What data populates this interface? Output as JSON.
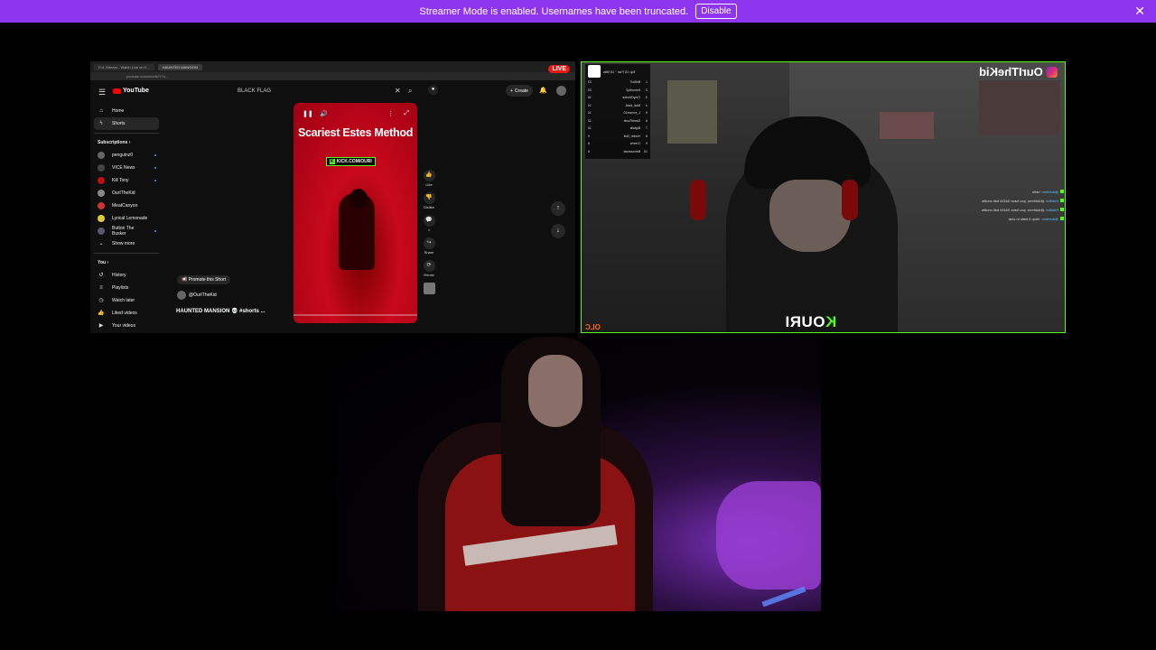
{
  "banner": {
    "message": "Streamer Mode is enabled. Usernames have been truncated.",
    "disable_label": "Disable",
    "close_glyph": "✕",
    "color": "#8e35f0"
  },
  "browser": {
    "tabs": [
      "Fu1 Stream - Watch Live on K...",
      "HAUNTED MANSION"
    ],
    "url": "youtube.com/shorts/Y7x...",
    "live_badge": "LIVE",
    "youtube": {
      "logo_text": "YouTube",
      "search_query": "BLACK FLAG",
      "create_label": "Create",
      "sidebar": {
        "items": [
          {
            "label": "Home",
            "icon": "home-icon",
            "glyph": "⌂"
          },
          {
            "label": "Shorts",
            "icon": "shorts-icon",
            "glyph": "ϟ"
          }
        ],
        "subscriptions_heading": "Subscriptions",
        "subscriptions": [
          {
            "label": "penguinz0",
            "color": "#666"
          },
          {
            "label": "VICE News",
            "color": "#444"
          },
          {
            "label": "Kill Tony",
            "color": "#b11"
          },
          {
            "label": "OurITheKid",
            "color": "#888"
          },
          {
            "label": "MeatCanyon",
            "color": "#c33"
          },
          {
            "label": "Lyrical Lemonade",
            "color": "#dc3"
          },
          {
            "label": "Button The Busker",
            "color": "#557"
          }
        ],
        "show_more": "Show more",
        "you_heading": "You",
        "you_items": [
          {
            "label": "History",
            "glyph": "↺"
          },
          {
            "label": "Playlists",
            "glyph": "≡"
          },
          {
            "label": "Watch later",
            "glyph": "◷"
          },
          {
            "label": "Liked videos",
            "glyph": "👍"
          },
          {
            "label": "Your videos",
            "glyph": "▶"
          }
        ]
      },
      "short": {
        "title_overlay": "Scariest Estes Method",
        "kick_tag": "KICK.COM/OURI",
        "promote_label": "Promote this Short",
        "channel": "@OurITheKid",
        "video_title": "HAUNTED MANSION 💀 #shorts ..."
      },
      "actions": [
        {
          "label": "Like",
          "glyph": "👍"
        },
        {
          "label": "Dislike",
          "glyph": "👎"
        },
        {
          "label": "1",
          "glyph": "💬"
        },
        {
          "label": "Share",
          "glyph": "↪"
        },
        {
          "label": "Remix",
          "glyph": "⟳"
        }
      ]
    }
  },
  "stream_cam": {
    "overlay_name": "OurITheKid",
    "brand_logo": "KOURI",
    "brand_k": "K",
    "brand_rest": "OURI",
    "corner_tag": "OLC",
    "leaderboard": {
      "title": "Top 10 Fan · 10 Bits",
      "rows": [
        {
          "rank": "1",
          "name": "BrtBoi7",
          "count": "23"
        },
        {
          "rank": "2",
          "name": "Kennethj2",
          "count": "20"
        },
        {
          "rank": "3",
          "name": "GmyGrindse",
          "count": "18"
        },
        {
          "rank": "4",
          "name": "Baal_bab1",
          "count": "14"
        },
        {
          "rank": "5",
          "name": "L_eoncre10",
          "count": "14"
        },
        {
          "rank": "6",
          "name": "SambRoofe",
          "count": "12"
        },
        {
          "rank": "7",
          "name": "Bigfalls",
          "count": "10"
        },
        {
          "rank": "8",
          "name": "Hunter_Boll",
          "count": "9"
        },
        {
          "rank": "9",
          "name": "Creehs",
          "count": "8"
        },
        {
          "rank": "10",
          "name": "Bennawrast",
          "count": "8"
        }
      ]
    },
    "chat": [
      {
        "user": "@dubhmn",
        "text": "hello"
      },
      {
        "user": "KickBot",
        "text": "@dubhmn, you have 34434 ball credits"
      },
      {
        "user": "KickBot",
        "text": "@dubhmn, you have 34434 ball credits"
      },
      {
        "user": "@dubhmn",
        "text": "!drop 5 balls in chat"
      }
    ]
  }
}
